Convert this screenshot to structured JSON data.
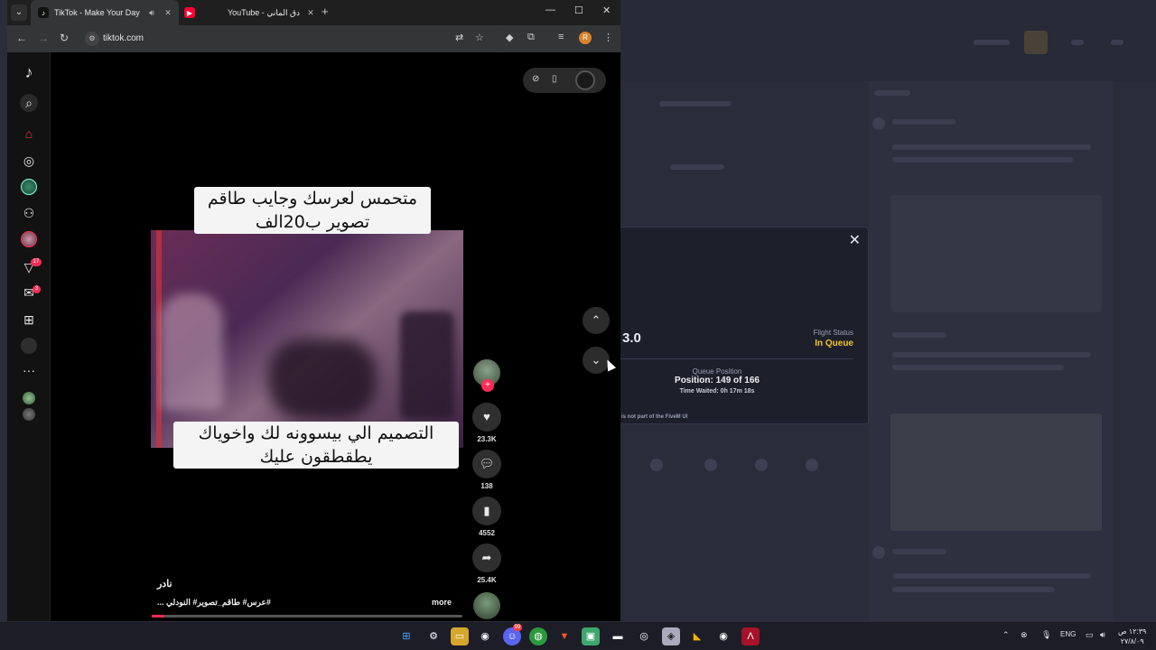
{
  "browser": {
    "tabs": [
      {
        "title": "TikTok - Make Your Day",
        "active": true
      },
      {
        "title": "YouTube - دق الماني",
        "active": false
      }
    ],
    "url": "tiktok.com",
    "profile_initial": "R"
  },
  "sidebar": {
    "notification_badges": {
      "activity": "17",
      "messages": "3"
    }
  },
  "video": {
    "caption_top_line1": "متحمس لعرسك وجايب طاقم",
    "caption_top_line2": "تصوير ب20الف",
    "caption_bottom_line1": "التصميم الي بيسوونه لك واخوياك",
    "caption_bottom_line2": "يطقطقون عليك",
    "author": "نادر",
    "description": "... عرس# طاقم_تصوير# النودلي#",
    "more_label": "more",
    "progress": 0.04
  },
  "actions": {
    "likes": "23.3K",
    "comments": "138",
    "saves": "4552",
    "shares": "25.4K"
  },
  "queue_dialog": {
    "version_partial": "3.0",
    "flight_status_label": "Flight Status",
    "flight_status_value": "In Queue",
    "queue_position_label": "Queue Position",
    "position_text": "Position: 149 of 166",
    "time_waited": "Time Waited: 0h 17m 18s",
    "disclaimer": "is not part of the FiveM UI"
  },
  "taskbar": {
    "language": "ENG",
    "time": "١٢:٣٩ ص",
    "date": "٢٧/٨/٠٩",
    "chat_badge": "99"
  },
  "colors": {
    "tiktok_accent": "#fe2c55",
    "queue_status": "#f2c629"
  }
}
